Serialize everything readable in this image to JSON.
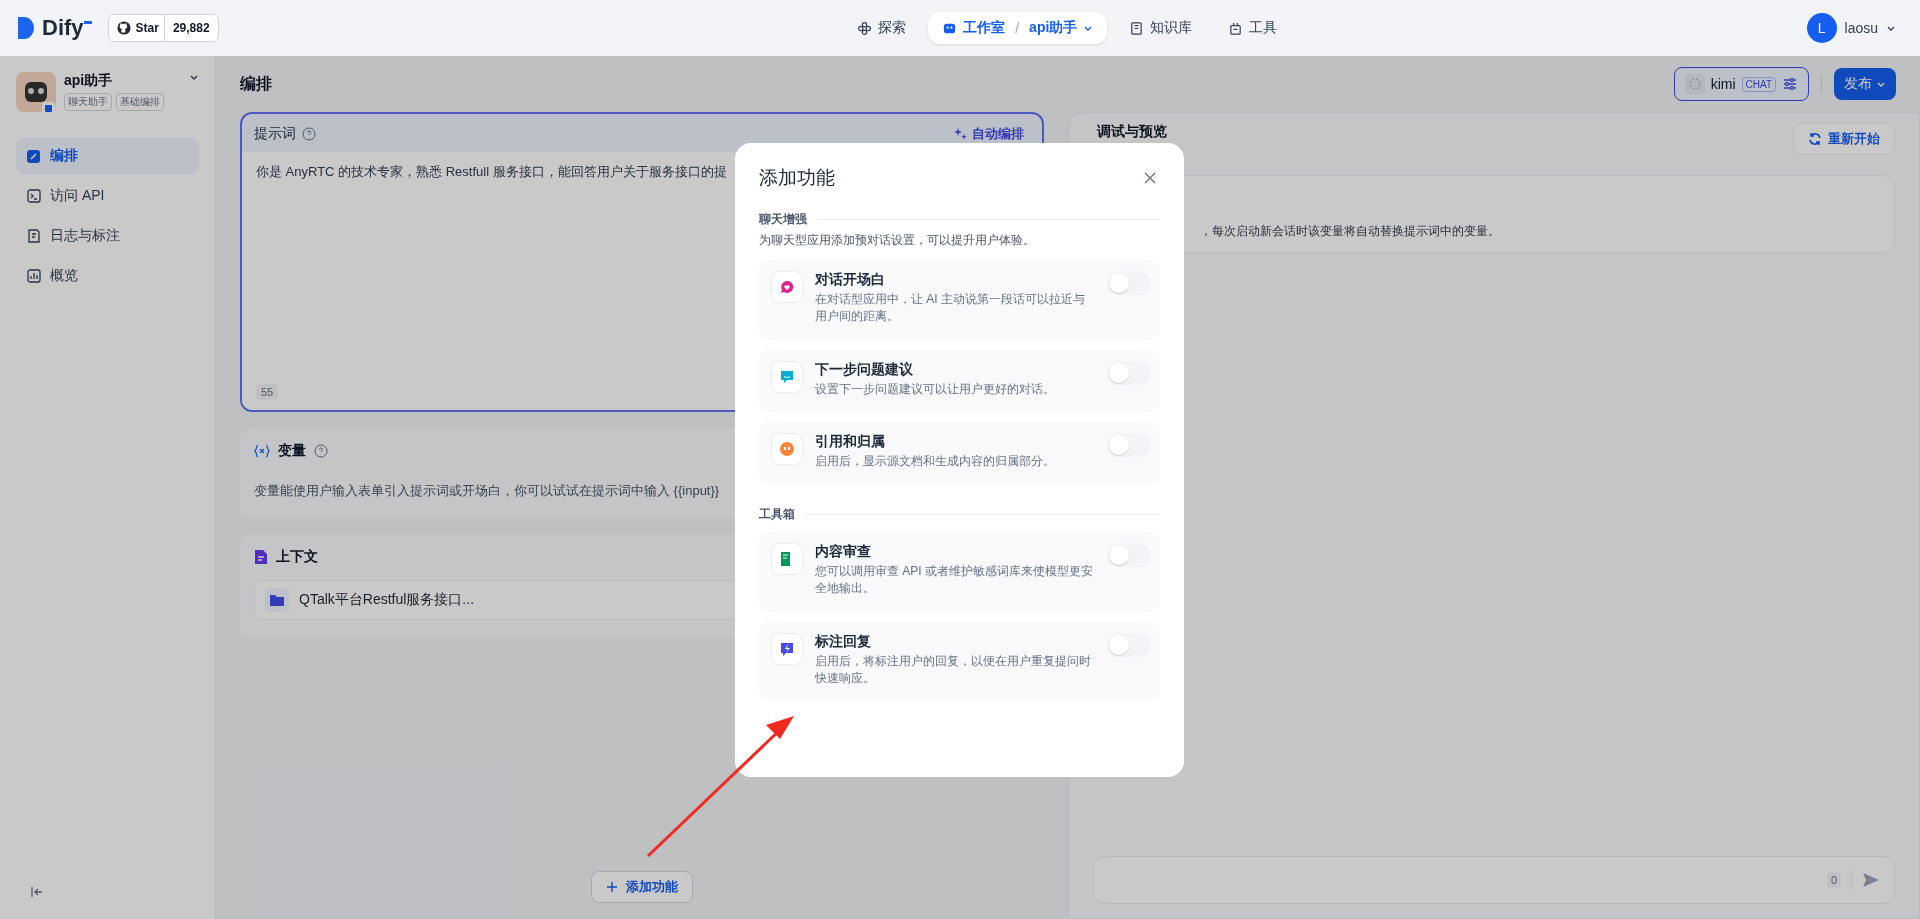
{
  "topbar": {
    "logo": "Dify",
    "github": {
      "label": "Star",
      "count": "29,882"
    },
    "nav": [
      {
        "label": "探索",
        "selected": false,
        "kind": "explore"
      },
      {
        "label": "工作室",
        "selected": true,
        "kind": "studio",
        "separator": "/",
        "app": "api助手"
      },
      {
        "label": "知识库",
        "selected": false,
        "kind": "knowledge"
      },
      {
        "label": "工具",
        "selected": false,
        "kind": "tools"
      }
    ],
    "user": {
      "initial": "L",
      "name": "laosu"
    }
  },
  "sidebar": {
    "app_name": "api助手",
    "tags": [
      "聊天助手",
      "基础编排"
    ],
    "items": [
      {
        "label": "编排",
        "selected": true,
        "kind": "orchestrate"
      },
      {
        "label": "访问 API",
        "selected": false,
        "kind": "api"
      },
      {
        "label": "日志与标注",
        "selected": false,
        "kind": "logs"
      },
      {
        "label": "概览",
        "selected": false,
        "kind": "overview"
      }
    ]
  },
  "header": {
    "title": "编排",
    "model": "kimi",
    "model_mode": "CHAT",
    "publish": "发布"
  },
  "prompt": {
    "title": "提示词",
    "auto": "自动编排",
    "text": "你是 AnyRTC 的技术专家，熟悉 Restfull 服务接口，能回答用户关于服务接口的提",
    "count": "55"
  },
  "variables": {
    "title": "变量",
    "description": "变量能使用户输入表单引入提示词或开场白，你可以试试在提示词中输入 {{input}}"
  },
  "context": {
    "title": "上下文",
    "items": [
      "QTalk平台Restful服务接口..."
    ]
  },
  "add_feature": "添加功能",
  "debug": {
    "title": "调试与预览",
    "restart": "重新开始",
    "note": "，每次启动新会话时该变量将自动替换提示词中的变量。",
    "count": "0"
  },
  "modal": {
    "title": "添加功能",
    "sections": [
      {
        "title": "聊天增强",
        "description": "为聊天型应用添加预对话设置，可以提升用户体验。",
        "items": [
          {
            "title": "对话开场白",
            "description": "在对话型应用中，让 AI 主动说第一段话可以拉近与用户间的距离。",
            "on": false,
            "color": "#dd2590",
            "kind": "opening"
          },
          {
            "title": "下一步问题建议",
            "description": "设置下一步问题建议可以让用户更好的对话。",
            "on": false,
            "color": "#06aed4",
            "kind": "suggest"
          },
          {
            "title": "引用和归属",
            "description": "启用后，显示源文档和生成内容的归属部分。",
            "on": false,
            "color": "#fd853a",
            "kind": "citation"
          }
        ]
      },
      {
        "title": "工具箱",
        "items": [
          {
            "title": "内容审查",
            "description": "您可以调用审查 API 或者维护敏感词库来使模型更安全地输出。",
            "on": false,
            "color": "#039855",
            "kind": "moderation"
          },
          {
            "title": "标注回复",
            "description": "启用后，将标注用户的回复，以便在用户重复提问时快速响应。",
            "on": false,
            "color": "#444ce7",
            "kind": "annotation"
          }
        ]
      }
    ]
  }
}
